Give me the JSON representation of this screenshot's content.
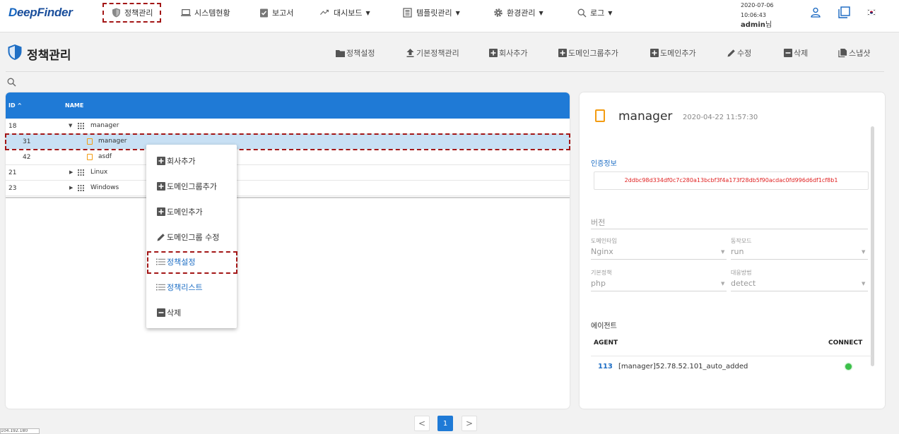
{
  "brand": {
    "logo_lead": "D",
    "logo_rest": "eepFinder"
  },
  "nav": {
    "policy": "정책관리",
    "system": "시스템현황",
    "report": "보고서",
    "dashboard": "대시보드",
    "template": "템플릿관리",
    "env": "환경관리",
    "log": "로그"
  },
  "session": {
    "date": "2020-07-06",
    "time": "10:06:43",
    "user": "admin",
    "suffix": "님"
  },
  "page": {
    "title": "정책관리"
  },
  "toolbar": {
    "policy_settings": "정책설정",
    "default_policy": "기본정책관리",
    "add_company": "회사추가",
    "add_domain_group": "도메인그룹추가",
    "add_domain": "도메인추가",
    "edit": "수정",
    "delete": "삭제",
    "snapshot": "스냅샷"
  },
  "table": {
    "col_id": "ID",
    "col_name": "NAME",
    "rows": [
      {
        "id": "18",
        "name": "manager"
      },
      {
        "id": "31",
        "name": "manager"
      },
      {
        "id": "42",
        "name": "asdf"
      },
      {
        "id": "21",
        "name": "Linux"
      },
      {
        "id": "23",
        "name": "Windows"
      }
    ]
  },
  "context_menu": {
    "add_company": "회사추가",
    "add_domain_group": "도메인그룹추가",
    "add_domain": "도메인추가",
    "edit_domain_group": "도메인그룹 수정",
    "policy_settings": "정책설정",
    "policy_list": "정책리스트",
    "delete": "삭제"
  },
  "detail": {
    "title": "manager",
    "timestamp": "2020-04-22 11:57:30",
    "auth_label": "인증정보",
    "auth_value": "2ddbc98d334df0c7c280a13bcbf3f4a173f28db5f90acdac0fd996d6df1cf8b1",
    "version_label": "버전",
    "domain_type_label": "도메인타입",
    "domain_type_value": "Nginx",
    "mode_label": "동작모드",
    "mode_value": "run",
    "default_policy_label": "기본정책",
    "default_policy_value": "php",
    "response_label": "대응방법",
    "response_value": "detect",
    "agent_section": "에이전트",
    "agent_col": "AGENT",
    "connect_col": "CONNECT",
    "agent_id": "113",
    "agent_name": "[manager]52.78.52.101_auto_added"
  },
  "pagination": {
    "prev": "<",
    "current": "1",
    "next": ">"
  },
  "corner": {
    "text": "104.192.180"
  },
  "colors": {
    "primary": "#1f7ad6",
    "highlight": "#a31616",
    "leaf": "#f39c12",
    "online": "#3cc04a",
    "auth": "#e02020"
  }
}
